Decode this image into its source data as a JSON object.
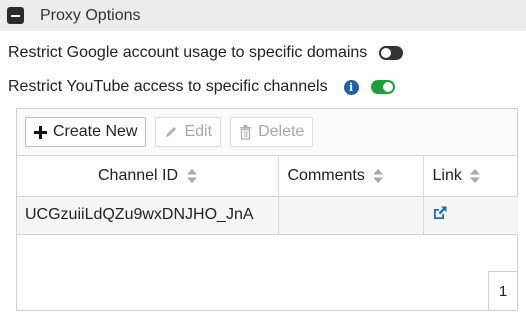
{
  "section": {
    "title": "Proxy Options"
  },
  "options": [
    {
      "label": "Restrict Google account usage to specific domains",
      "enabled": false
    },
    {
      "label": "Restrict YouTube access to specific channels",
      "enabled": true
    }
  ],
  "toolbar": {
    "create_label": "Create New",
    "edit_label": "Edit",
    "delete_label": "Delete"
  },
  "table": {
    "columns": [
      "Channel ID",
      "Comments",
      "Link"
    ],
    "rows": [
      {
        "channel_id": "UCGzuiiLdQZu9wxDNJHO_JnA",
        "comments": "",
        "link_icon": "external-link-icon"
      }
    ]
  },
  "pager": {
    "page": "1"
  },
  "colors": {
    "toggle_on": "#1aa33b",
    "toggle_off": "#333333",
    "info": "#1d5fa8",
    "link": "#1d6fb8"
  }
}
